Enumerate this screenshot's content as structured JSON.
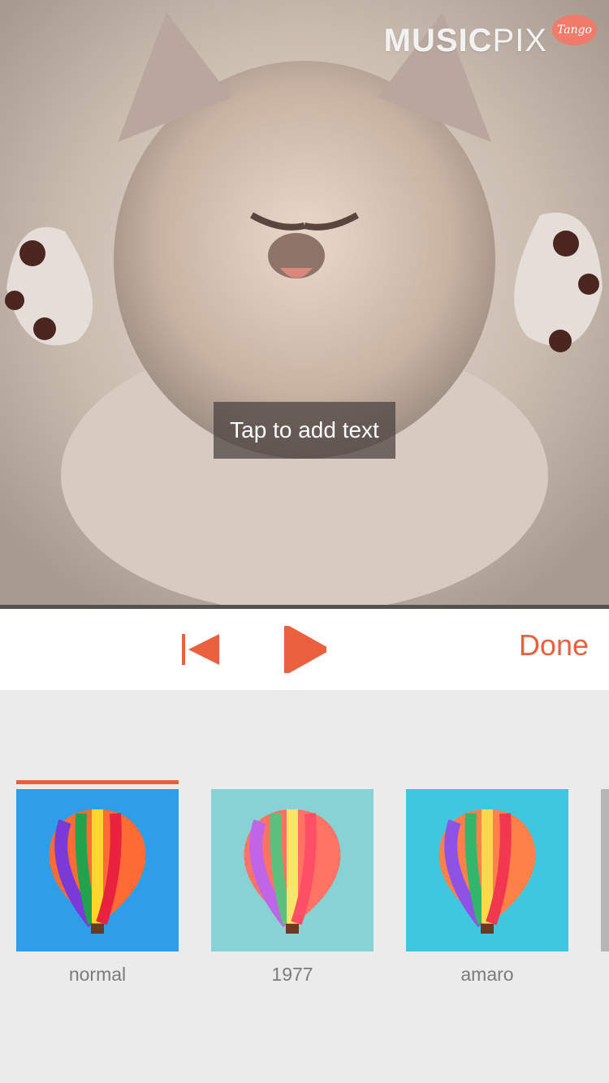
{
  "photo": {
    "subject": "sleeping kitten"
  },
  "branding": {
    "logo_bold": "MUSIC",
    "logo_thin": "PIX",
    "badge": "Tango"
  },
  "editor": {
    "add_text_hint": "Tap to add text"
  },
  "controls": {
    "done_label": "Done",
    "prev_icon": "skip-back-icon",
    "play_icon": "play-icon",
    "accent": "#ea5f3c"
  },
  "filters": [
    {
      "label": "normal",
      "selected": true
    },
    {
      "label": "1977",
      "selected": false
    },
    {
      "label": "amaro",
      "selected": false
    }
  ]
}
